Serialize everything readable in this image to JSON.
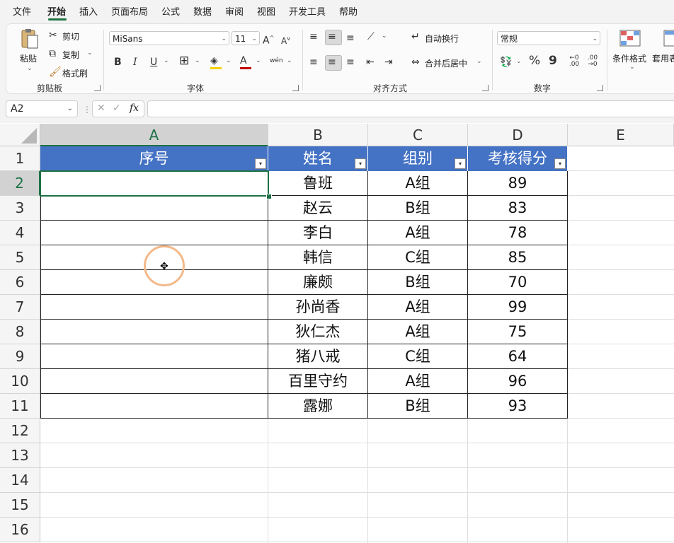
{
  "menu": {
    "tabs": [
      "文件",
      "开始",
      "插入",
      "页面布局",
      "公式",
      "数据",
      "审阅",
      "视图",
      "开发工具",
      "帮助"
    ],
    "active": "开始"
  },
  "ribbon": {
    "clipboard": {
      "paste": "粘贴",
      "cut": "剪切",
      "copy": "复制",
      "format_painter": "格式刷",
      "label": "剪贴板"
    },
    "font": {
      "font_name": "MiSans",
      "font_size": "11",
      "bold": "B",
      "italic": "I",
      "underline": "U",
      "phonetic": "wén",
      "label": "字体"
    },
    "alignment": {
      "wrap_text": "自动换行",
      "merge_center": "合并后居中",
      "label": "对齐方式"
    },
    "number": {
      "format": "常规",
      "percent": "%",
      "comma": "9",
      "inc_decimal": "←0 .00",
      "dec_decimal": ".00 →0",
      "label": "数字"
    },
    "styles": {
      "conditional_format": "条件格式",
      "table_format": "套用表格格式"
    }
  },
  "formula_bar": {
    "name_box": "A2",
    "fx": "fx",
    "cancel": "✕",
    "confirm": "✓",
    "value": ""
  },
  "grid": {
    "columns": [
      "A",
      "B",
      "C",
      "D",
      "E"
    ],
    "rows": [
      "1",
      "2",
      "3",
      "4",
      "5",
      "6",
      "7",
      "8",
      "9",
      "10",
      "11",
      "12",
      "13",
      "14",
      "15",
      "16"
    ],
    "selected_cell": "A2",
    "header_color": "#4472c4",
    "accent": "#1e7145",
    "table_headers": [
      "序号",
      "姓名",
      "组别",
      "考核得分"
    ],
    "table_rows": [
      [
        "",
        "鲁班",
        "A组",
        "89"
      ],
      [
        "",
        "赵云",
        "B组",
        "83"
      ],
      [
        "",
        "李白",
        "A组",
        "78"
      ],
      [
        "",
        "韩信",
        "C组",
        "85"
      ],
      [
        "",
        "廉颇",
        "B组",
        "70"
      ],
      [
        "",
        "孙尚香",
        "A组",
        "99"
      ],
      [
        "",
        "狄仁杰",
        "A组",
        "75"
      ],
      [
        "",
        "猪八戒",
        "C组",
        "64"
      ],
      [
        "",
        "百里守约",
        "A组",
        "96"
      ],
      [
        "",
        "露娜",
        "B组",
        "93"
      ]
    ]
  }
}
